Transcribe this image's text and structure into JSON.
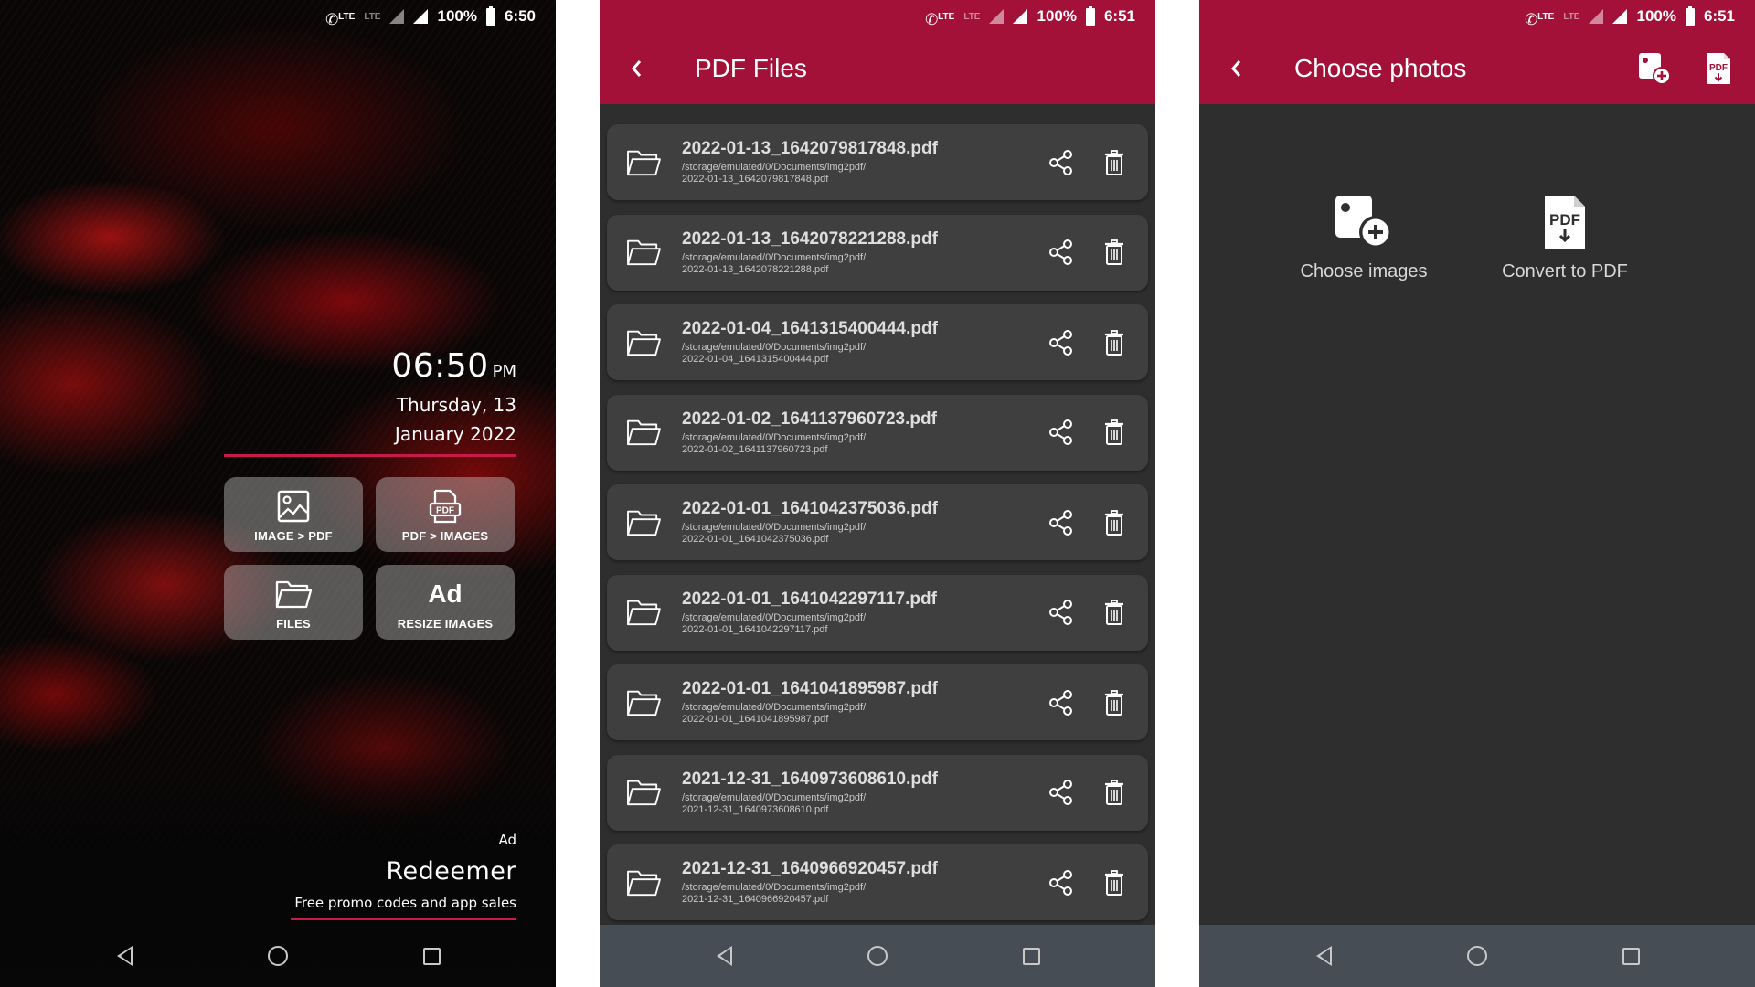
{
  "colors": {
    "brand": "#a31038",
    "accent_line": "#c51a4a",
    "dark_bg": "#2e2e2e",
    "card_bg": "#3f3f3f",
    "nav_bg": "#464d54"
  },
  "screens": [
    {
      "name": "home-screen",
      "status": {
        "network_1": "LTE",
        "network_2": "LTE",
        "battery": "100%",
        "time": "6:50"
      },
      "clock": {
        "time": "06:50",
        "ampm": "PM",
        "date_line1": "Thursday, 13",
        "date_line2": "January 2022"
      },
      "tiles": [
        {
          "label": "IMAGE > PDF",
          "icon": "image-icon"
        },
        {
          "label": "PDF > IMAGES",
          "icon": "pdf-file-icon"
        },
        {
          "label": "FILES",
          "icon": "folder-icon"
        },
        {
          "label": "RESIZE IMAGES",
          "icon": "ad-badge",
          "badge": "Ad"
        }
      ],
      "ad": {
        "tag": "Ad",
        "title": "Redeemer",
        "subtitle": "Free promo codes and app sales"
      }
    },
    {
      "name": "pdf-files-screen",
      "status": {
        "network_1": "LTE",
        "network_2": "LTE",
        "battery": "100%",
        "time": "6:51"
      },
      "title": "PDF Files",
      "files": [
        {
          "name": "2022-01-13_1642079817848.pdf",
          "dir": "/storage/emulated/0/Documents/img2pdf/",
          "file": "2022-01-13_1642079817848.pdf"
        },
        {
          "name": "2022-01-13_1642078221288.pdf",
          "dir": "/storage/emulated/0/Documents/img2pdf/",
          "file": "2022-01-13_1642078221288.pdf"
        },
        {
          "name": "2022-01-04_1641315400444.pdf",
          "dir": "/storage/emulated/0/Documents/img2pdf/",
          "file": "2022-01-04_1641315400444.pdf"
        },
        {
          "name": "2022-01-02_1641137960723.pdf",
          "dir": "/storage/emulated/0/Documents/img2pdf/",
          "file": "2022-01-02_1641137960723.pdf"
        },
        {
          "name": "2022-01-01_1641042375036.pdf",
          "dir": "/storage/emulated/0/Documents/img2pdf/",
          "file": "2022-01-01_1641042375036.pdf"
        },
        {
          "name": "2022-01-01_1641042297117.pdf",
          "dir": "/storage/emulated/0/Documents/img2pdf/",
          "file": "2022-01-01_1641042297117.pdf"
        },
        {
          "name": "2022-01-01_1641041895987.pdf",
          "dir": "/storage/emulated/0/Documents/img2pdf/",
          "file": "2022-01-01_1641041895987.pdf"
        },
        {
          "name": "2021-12-31_1640973608610.pdf",
          "dir": "/storage/emulated/0/Documents/img2pdf/",
          "file": "2021-12-31_1640973608610.pdf"
        },
        {
          "name": "2021-12-31_1640966920457.pdf",
          "dir": "/storage/emulated/0/Documents/img2pdf/",
          "file": "2021-12-31_1640966920457.pdf"
        }
      ]
    },
    {
      "name": "choose-photos-screen",
      "status": {
        "network_1": "LTE",
        "network_2": "LTE",
        "battery": "100%",
        "time": "6:51"
      },
      "title": "Choose photos",
      "actions": [
        {
          "icon": "add-image-icon"
        },
        {
          "icon": "pdf-download-icon",
          "text": "PDF"
        }
      ],
      "options": [
        {
          "label": "Choose images",
          "icon": "add-image-icon"
        },
        {
          "label": "Convert to PDF",
          "icon": "pdf-download-icon",
          "icon_text": "PDF"
        }
      ]
    }
  ]
}
